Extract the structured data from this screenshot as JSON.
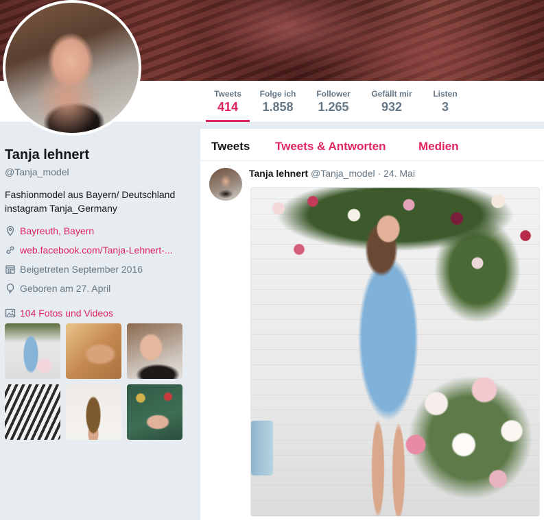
{
  "profile": {
    "name": "Tanja lehnert",
    "handle": "@Tanja_model",
    "bio_line1": "Fashionmodel aus Bayern/ Deutschland",
    "bio_line2": "instagram Tanja_Germany",
    "location": "Bayreuth, Bayern",
    "website": "web.facebook.com/Tanja-Lehnert-...",
    "joined": "Beigetreten September 2016",
    "birthday": "Geboren am 27. April",
    "media_link": "104 Fotos und Videos"
  },
  "stats": [
    {
      "label": "Tweets",
      "value": "414"
    },
    {
      "label": "Folge ich",
      "value": "1.858"
    },
    {
      "label": "Follower",
      "value": "1.265"
    },
    {
      "label": "Gefällt mir",
      "value": "932"
    },
    {
      "label": "Listen",
      "value": "3"
    }
  ],
  "tabs": {
    "tweets": "Tweets",
    "replies": "Tweets & Antworten",
    "media": "Medien"
  },
  "tweet": {
    "author": "Tanja lehnert",
    "handle": "@Tanja_model",
    "separator": "·",
    "date": "24. Mai"
  },
  "colors": {
    "accent": "#e0245e",
    "muted": "#657786",
    "background": "#e6ecf0"
  },
  "icons": {
    "location": "location-pin-icon",
    "link": "link-icon",
    "calendar": "calendar-icon",
    "birthday": "balloon-icon",
    "media": "image-icon"
  }
}
